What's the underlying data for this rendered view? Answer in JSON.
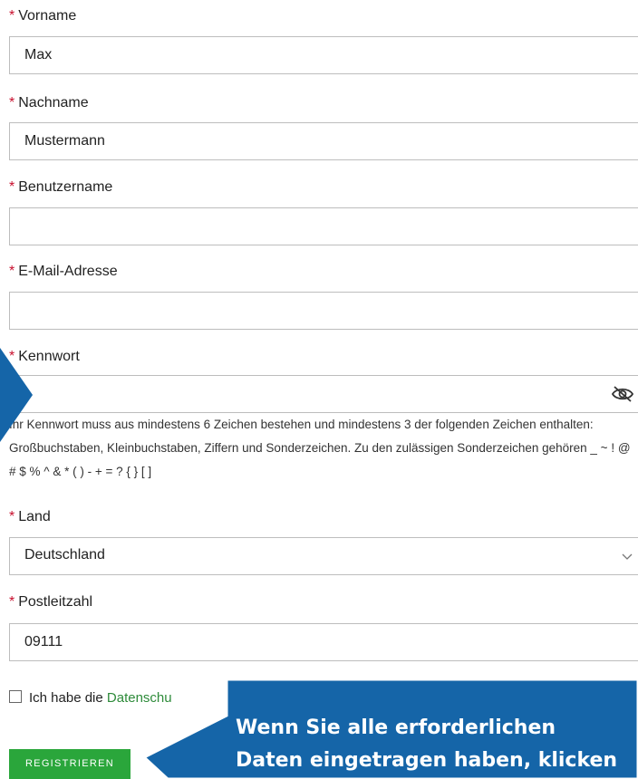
{
  "form": {
    "required_mark": "*",
    "first_name": {
      "label": "Vorname",
      "value": "Max"
    },
    "last_name": {
      "label": "Nachname",
      "value": "Mustermann"
    },
    "username": {
      "label": "Benutzername",
      "value": ""
    },
    "email": {
      "label": "E-Mail-Adresse",
      "value": ""
    },
    "password": {
      "label": "Kennwort",
      "value": "",
      "hint": "Ihr Kennwort muss aus mindestens 6 Zeichen bestehen und mindestens 3 der folgenden Zeichen enthalten: Großbuchstaben, Kleinbuchstaben, Ziffern und Sonderzeichen. Zu den zulässigen Sonderzeichen gehören _ ~ ! @ # $ % ^ & * ( ) - + = ? { } [ ]"
    },
    "country": {
      "label": "Land",
      "value": "Deutschland"
    },
    "postal_code": {
      "label": "Postleitzahl",
      "value": "09111"
    },
    "consent": {
      "text": "Ich habe die ",
      "link": "Datenschu",
      "checked": false
    },
    "submit_label": "REGISTRIEREN"
  },
  "callout": {
    "line1": "Wenn Sie alle erforderlichen",
    "line2": "Daten eingetragen haben, klicken"
  },
  "colors": {
    "required": "#c8102e",
    "button": "#2aa63b",
    "link": "#2e8b3a",
    "callout": "#1565a8"
  }
}
